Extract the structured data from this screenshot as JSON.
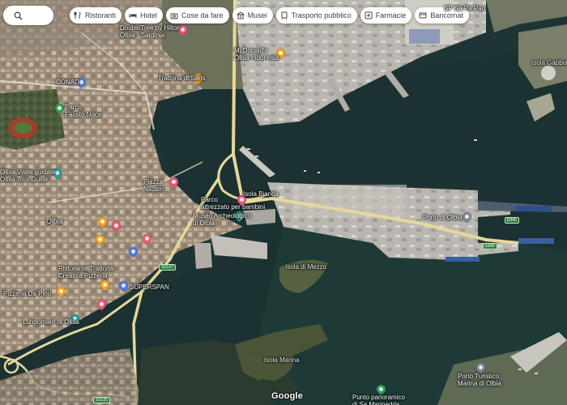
{
  "search": {
    "icon": "search-icon"
  },
  "chips": [
    {
      "label": "Ristoranti",
      "icon": "fork-knife-icon"
    },
    {
      "label": "Hotel",
      "icon": "bed-icon"
    },
    {
      "label": "Cose da fare",
      "icon": "camera-icon"
    },
    {
      "label": "Musei",
      "icon": "museum-icon"
    },
    {
      "label": "Trasporto pubblico",
      "icon": "train-icon"
    },
    {
      "label": "Farmacie",
      "icon": "pharmacy-icon"
    },
    {
      "label": "Bancomat",
      "icon": "atm-icon"
    }
  ],
  "places": {
    "doubletree": "DoubleTree by Hilton\nOlbia - Sardinia",
    "mcdonalds": "McDonald's\nOlbia Indonesia",
    "conad": "CONAD",
    "parco": "Parco\nFausto Noce",
    "trattoria_saris": "Trattoria di Saris",
    "olbia_guides": "Olbia Visite guidate\nOlbia Tour Guide",
    "parco_attrezzato": "Parco\nattrezzato per bambini",
    "museo": "Museo Archeologico\ndi Olbia",
    "isola_bianca": "Isola Bianca",
    "porto_olbia": "Porto di Olbia",
    "olbia": "Olbia",
    "superspan": "SUPERSPAN",
    "ristorante": "Ristorante Trattoria\nCreativa Pizzeria",
    "pizzeria": "Pizzeria Da Pino",
    "lungomare": "Lungomare di Olbia",
    "isola_mezzo": "Isola di Mezzo",
    "isola_manna": "Isola Manna",
    "isola_gabbia": "Isola Gabbia",
    "porto_turistico": "Porto Turistico\nMarina di Olbia",
    "punto": "Punto panoramico\ndi Sa Marinedda",
    "sp": "SP Sa Pa Pau",
    "piazza": "Piazza\nNazion..."
  },
  "roads": [
    "E840",
    "E840",
    "SS127",
    "SS125"
  ],
  "attribution": "Google"
}
